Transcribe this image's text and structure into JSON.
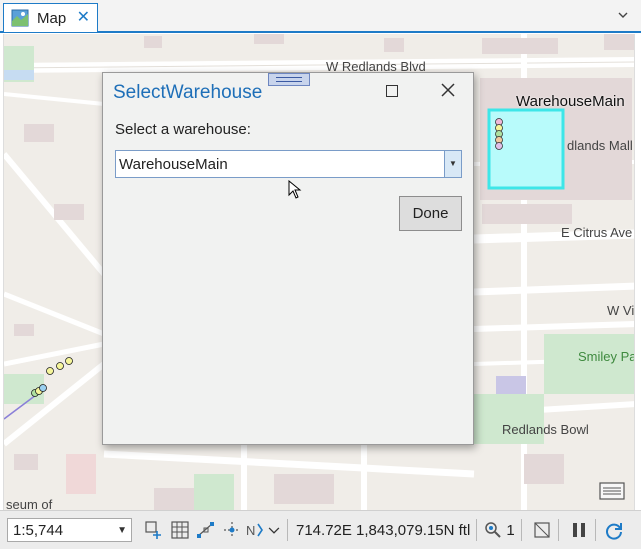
{
  "tab": {
    "label": "Map",
    "close": "✕"
  },
  "map": {
    "labels": {
      "redlands_blvd": "W Redlands Blvd",
      "warehouse_main": "WarehouseMain",
      "redlands_mall": "dlands Mall",
      "citrus": "E Citrus Ave",
      "w_vi": "W Vi",
      "smiley": "Smiley Pa",
      "bowl": "Redlands Bowl",
      "museum": "seum of"
    },
    "colors": {
      "warehouse_fill": "#b8fbfb",
      "warehouse_stroke": "#3de6e8",
      "park": "#cfe8cf",
      "building": "#e3d8d8",
      "water": "#c6dcf2"
    }
  },
  "dialog": {
    "title": "SelectWarehouse",
    "prompt": "Select a warehouse:",
    "selected": "WarehouseMain",
    "done_label": "Done"
  },
  "status": {
    "scale": "1:5,744",
    "coords": "714.72E 1,843,079.15N ftl",
    "selection_count": "1"
  }
}
